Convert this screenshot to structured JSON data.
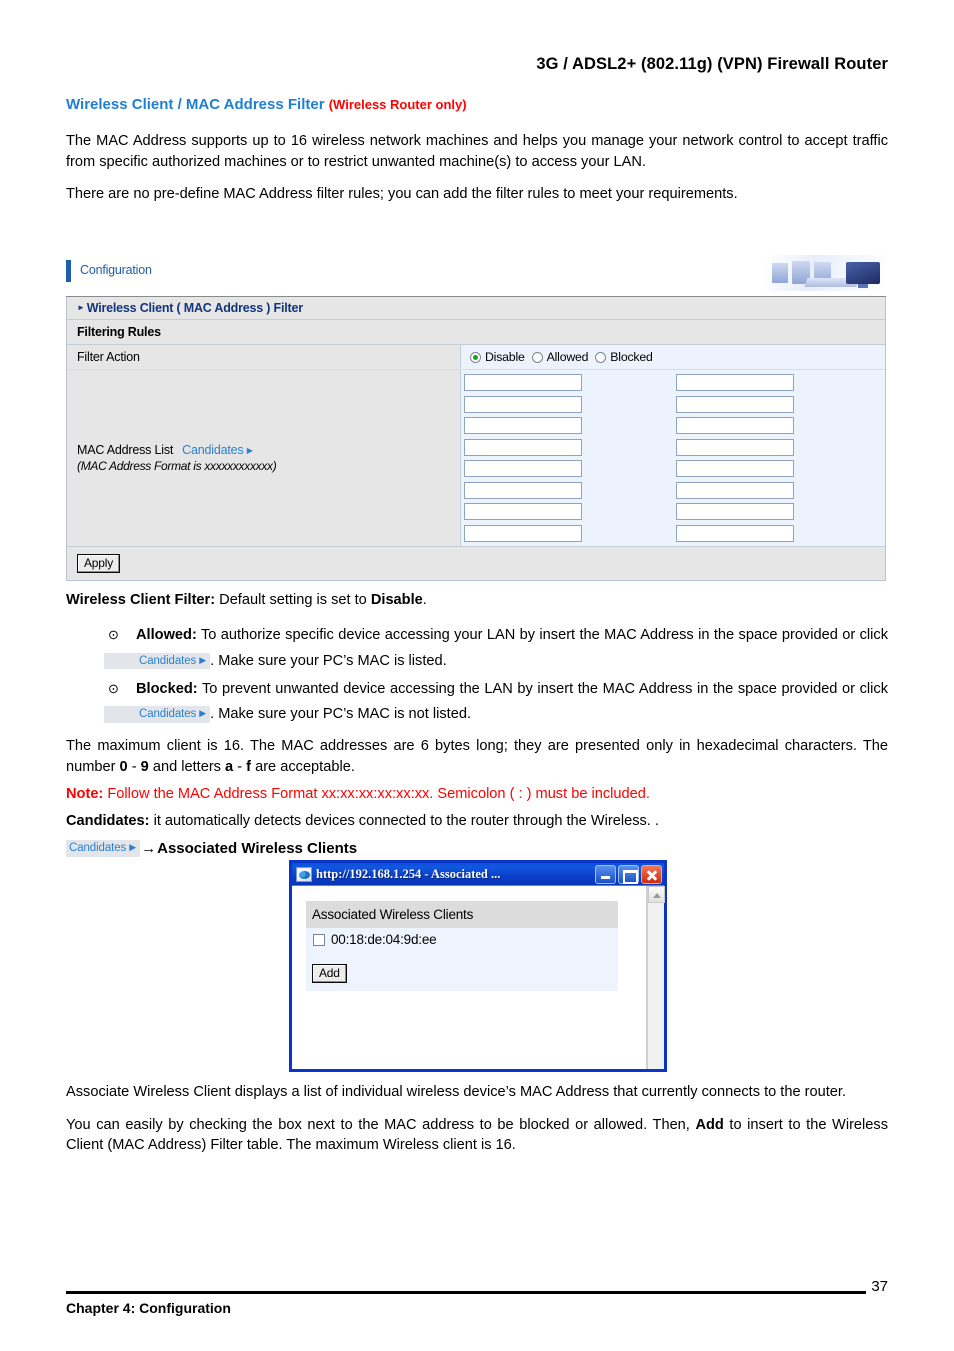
{
  "running_head": "3G / ADSL2+ (802.11g) (VPN) Firewall Router",
  "section": {
    "title_main": "Wireless Client / MAC Address Filter",
    "title_qualifier": "(Wireless Router only)"
  },
  "intro": {
    "p1": "The MAC Address supports up to 16 wireless network machines and helps you manage your network control to accept traffic from specific authorized machines or to restrict unwanted machine(s) to access your LAN.",
    "p2": "There are no pre-define MAC Address filter rules; you can add the filter rules to meet your requirements."
  },
  "panel": {
    "header_title": "Configuration",
    "section_title": "Wireless Client ( MAC Address ) Filter",
    "subsection_title": "Filtering Rules",
    "filter_action_label": "Filter Action",
    "filter_action_options": [
      {
        "label": "Disable",
        "selected": true
      },
      {
        "label": "Allowed",
        "selected": false
      },
      {
        "label": "Blocked",
        "selected": false
      }
    ],
    "mac_list_label": "MAC Address List",
    "candidates_link": "Candidates",
    "candidates_arrow": "▶",
    "mac_format_hint": "(MAC Address Format is xxxxxxxxxxxx)",
    "mac_input_rows": 8,
    "mac_input_cols": 2,
    "mac_inputs_total": 16,
    "apply_label": "Apply"
  },
  "explain": {
    "filter_default_label": "Wireless Client Filter:",
    "filter_default_text": " Default setting is set to ",
    "filter_default_value": "Disable",
    "filter_default_end": ".",
    "allowed_label": "Allowed:",
    "allowed_text_1": " To authorize specific device accessing your LAN by insert the MAC Address in the space provided or click ",
    "allowed_text_2": ".   Make sure your PC’s MAC is listed.",
    "blocked_label": "Blocked:",
    "blocked_text_1": " To prevent unwanted device accessing the LAN by insert the MAC Address in the space provided or click ",
    "blocked_text_2": ". Make sure your PC’s MAC is not listed.",
    "bullet_glyph": "⊙",
    "max_client_1": "The maximum client is 16.   The MAC addresses are 6 bytes long; they are presented only in hexadecimal characters.   The number ",
    "max_client_b1": "0",
    "max_client_2": " - ",
    "max_client_b2": "9",
    "max_client_3": " and letters ",
    "max_client_b3": "a",
    "max_client_4": " - ",
    "max_client_b4": "f",
    "max_client_5": " are acceptable.",
    "note_label": "Note:",
    "note_text": "   Follow the MAC Address Format xx:xx:xx:xx:xx:xx.   Semicolon ( : ) must be included.",
    "candidates_label": "Candidates:",
    "candidates_text": "   it automatically detects devices connected to the router through the Wireless. .",
    "assoc_arrow": "→",
    "assoc_heading": "Associated Wireless Clients"
  },
  "dialog": {
    "title": "http://192.168.1.254 - Associated ...",
    "min_label": "Minimize",
    "max_label": "Maximize",
    "close_label": "Close",
    "list_header": "Associated Wireless Clients",
    "client_mac": "00:18:de:04:9d:ee",
    "client_checked": false,
    "add_label": "Add"
  },
  "closing": {
    "p1": "Associate Wireless Client displays a list of individual wireless device’s MAC Address that currently connects to the router.",
    "p2_1": "You can easily by checking the box next to the MAC address to be blocked or allowed. Then, ",
    "p2_bold": "Add",
    "p2_2": " to insert to the Wireless Client (MAC Address) Filter table.   The maximum Wireless client is 16."
  },
  "footer": {
    "chapter": "Chapter 4: Configuration",
    "page_number": "37"
  }
}
